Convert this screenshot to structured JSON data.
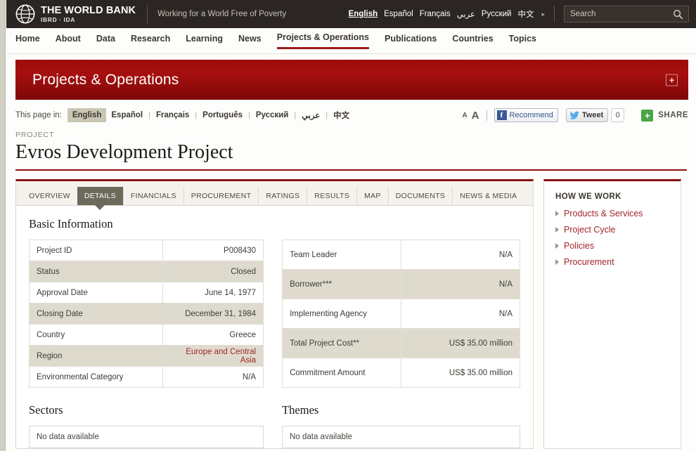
{
  "topbar": {
    "brand_name": "THE WORLD BANK",
    "brand_sub": "IBRD · IDA",
    "tagline": "Working for a World Free of Poverty",
    "languages": [
      {
        "label": "English",
        "selected": true
      },
      {
        "label": "Español",
        "selected": false
      },
      {
        "label": "Français",
        "selected": false
      },
      {
        "label": "عربي",
        "selected": false
      },
      {
        "label": "Русский",
        "selected": false
      },
      {
        "label": "中文",
        "selected": false
      }
    ],
    "more_arrow": "▸",
    "search_placeholder": "Search"
  },
  "mainnav": {
    "items": [
      {
        "label": "Home",
        "active": false
      },
      {
        "label": "About",
        "active": false
      },
      {
        "label": "Data",
        "active": false
      },
      {
        "label": "Research",
        "active": false
      },
      {
        "label": "Learning",
        "active": false
      },
      {
        "label": "News",
        "active": false
      },
      {
        "label": "Projects & Operations",
        "active": true
      },
      {
        "label": "Publications",
        "active": false
      },
      {
        "label": "Countries",
        "active": false
      },
      {
        "label": "Topics",
        "active": false
      }
    ]
  },
  "banner": {
    "title": "Projects & Operations",
    "expand_label": "+",
    "color": "#9e0b0b"
  },
  "utility": {
    "this_page_in": "This page in:",
    "page_languages": [
      {
        "label": "English",
        "current": true
      },
      {
        "label": "Español",
        "current": false
      },
      {
        "label": "Français",
        "current": false
      },
      {
        "label": "Português",
        "current": false
      },
      {
        "label": "Русский",
        "current": false
      },
      {
        "label": "عربي",
        "current": false
      },
      {
        "label": "中文",
        "current": false
      }
    ],
    "font_small": "A",
    "font_large": "A",
    "facebook_label": "Recommend",
    "facebook_icon_glyph": "f",
    "twitter_label": "Tweet",
    "twitter_count": "0",
    "share_plus": "+",
    "share_label": "SHARE"
  },
  "project": {
    "eyebrow": "PROJECT",
    "title": "Evros Development Project"
  },
  "tabs": [
    {
      "label": "OVERVIEW",
      "active": false
    },
    {
      "label": "DETAILS",
      "active": true
    },
    {
      "label": "FINANCIALS",
      "active": false
    },
    {
      "label": "PROCUREMENT",
      "active": false
    },
    {
      "label": "RATINGS",
      "active": false
    },
    {
      "label": "RESULTS",
      "active": false
    },
    {
      "label": "MAP",
      "active": false
    },
    {
      "label": "DOCUMENTS",
      "active": false
    },
    {
      "label": "NEWS & MEDIA",
      "active": false
    }
  ],
  "basic_information": {
    "heading": "Basic Information",
    "left_rows": [
      {
        "label": "Project ID",
        "value": "P008430",
        "link": false
      },
      {
        "label": "Status",
        "value": "Closed",
        "link": false
      },
      {
        "label": "Approval Date",
        "value": "June 14, 1977",
        "link": false
      },
      {
        "label": "Closing Date",
        "value": "December 31, 1984",
        "link": false
      },
      {
        "label": "Country",
        "value": "Greece",
        "link": false
      },
      {
        "label": "Region",
        "value": "Europe and Central Asia",
        "link": true
      },
      {
        "label": "Environmental Category",
        "value": "N/A",
        "link": false
      }
    ],
    "right_rows": [
      {
        "label": "Team Leader",
        "value": "N/A"
      },
      {
        "label": "Borrower***",
        "value": "N/A"
      },
      {
        "label": "Implementing Agency",
        "value": "N/A"
      },
      {
        "label": "Total Project Cost**",
        "value": "US$ 35.00  million"
      },
      {
        "label": "Commitment Amount",
        "value": "US$ 35.00  million"
      }
    ]
  },
  "bottom": {
    "sectors_heading": "Sectors",
    "sectors_nodata": "No data available",
    "themes_heading": "Themes",
    "themes_nodata": "No data available"
  },
  "sidebar": {
    "heading": "HOW WE WORK",
    "items": [
      {
        "label": "Products & Services"
      },
      {
        "label": "Project Cycle"
      },
      {
        "label": "Policies"
      },
      {
        "label": "Procurement"
      }
    ]
  }
}
